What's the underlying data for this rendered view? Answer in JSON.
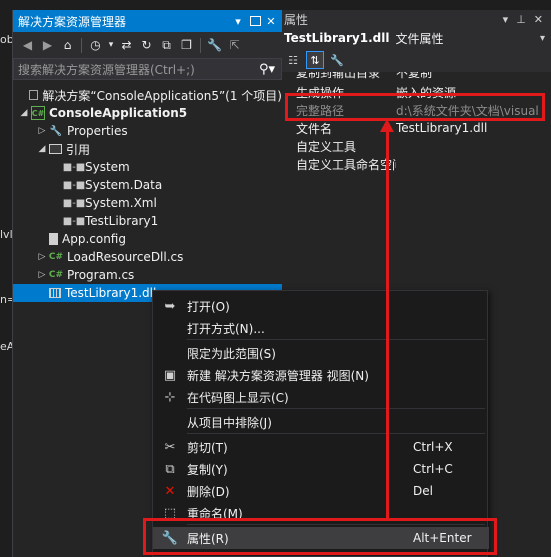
{
  "editor_fragments": [
    "ob",
    "lvl",
    "n=",
    "eA"
  ],
  "solution_explorer": {
    "title": "解决方案资源管理器",
    "search_placeholder": "搜索解决方案资源管理器(Ctrl+;)",
    "tree": [
      {
        "label": "解决方案“ConsoleApplication5”(1 个项目)",
        "icon": "solution-icon",
        "arrow": "",
        "indent": 0,
        "bold": false
      },
      {
        "label": "ConsoleApplication5",
        "icon": "csharp-project-icon",
        "arrow": "expanded",
        "indent": 0,
        "bold": true
      },
      {
        "label": "Properties",
        "icon": "wrench-icon",
        "arrow": "collapsed",
        "indent": 1,
        "bold": false
      },
      {
        "label": "引用",
        "icon": "references-icon",
        "arrow": "expanded",
        "indent": 1,
        "bold": false
      },
      {
        "label": "System",
        "icon": "assembly-reference-icon",
        "arrow": "",
        "indent": 2,
        "bold": false
      },
      {
        "label": "System.Data",
        "icon": "assembly-reference-icon",
        "arrow": "",
        "indent": 2,
        "bold": false
      },
      {
        "label": "System.Xml",
        "icon": "assembly-reference-icon",
        "arrow": "",
        "indent": 2,
        "bold": false
      },
      {
        "label": "TestLibrary1",
        "icon": "assembly-reference-icon",
        "arrow": "",
        "indent": 2,
        "bold": false
      },
      {
        "label": "App.config",
        "icon": "config-file-icon",
        "arrow": "",
        "indent": 1,
        "bold": false
      },
      {
        "label": "LoadResourceDll.cs",
        "icon": "csharp-file-icon",
        "arrow": "collapsed",
        "indent": 1,
        "bold": false
      },
      {
        "label": "Program.cs",
        "icon": "csharp-file-icon",
        "arrow": "collapsed",
        "indent": 1,
        "bold": false
      },
      {
        "label": "TestLibrary1.dll",
        "icon": "dll-file-icon",
        "arrow": "",
        "indent": 1,
        "bold": false,
        "selected": true
      }
    ]
  },
  "properties": {
    "title": "属性",
    "object_name": "TestLibrary1.dll",
    "object_kind": "文件属性",
    "rows": [
      {
        "name": "复制到输出目录",
        "value": "不复制"
      },
      {
        "name": "生成操作",
        "value": "嵌入的资源"
      },
      {
        "name": "完整路径",
        "value": "d:\\系统文件夹\\文档\\visual"
      },
      {
        "name": "文件名",
        "value": "TestLibrary1.dll"
      },
      {
        "name": "自定义工具",
        "value": ""
      },
      {
        "name": "自定义工具命名空间",
        "value": ""
      }
    ]
  },
  "context_menu": {
    "items": [
      {
        "label": "打开(O)",
        "shortcut": "",
        "icon": "open-icon"
      },
      {
        "label": "打开方式(N)...",
        "shortcut": "",
        "icon": ""
      },
      {
        "label": "限定为此范围(S)",
        "shortcut": "",
        "icon": ""
      },
      {
        "label": "新建 解决方案资源管理器 视图(N)",
        "shortcut": "",
        "icon": "new-view-icon"
      },
      {
        "label": "在代码图上显示(C)",
        "shortcut": "",
        "icon": "code-map-icon"
      },
      {
        "label": "从项目中排除(J)",
        "shortcut": "",
        "icon": ""
      },
      {
        "label": "剪切(T)",
        "shortcut": "Ctrl+X",
        "icon": "cut-icon"
      },
      {
        "label": "复制(Y)",
        "shortcut": "Ctrl+C",
        "icon": "copy-icon"
      },
      {
        "label": "删除(D)",
        "shortcut": "Del",
        "icon": "delete-icon"
      },
      {
        "label": "重命名(M)",
        "shortcut": "",
        "icon": "rename-icon"
      },
      {
        "label": "属性(R)",
        "shortcut": "Alt+Enter",
        "icon": "wrench-icon"
      }
    ]
  },
  "colors": {
    "accent": "#007acc",
    "highlight": "#e01a1a"
  }
}
